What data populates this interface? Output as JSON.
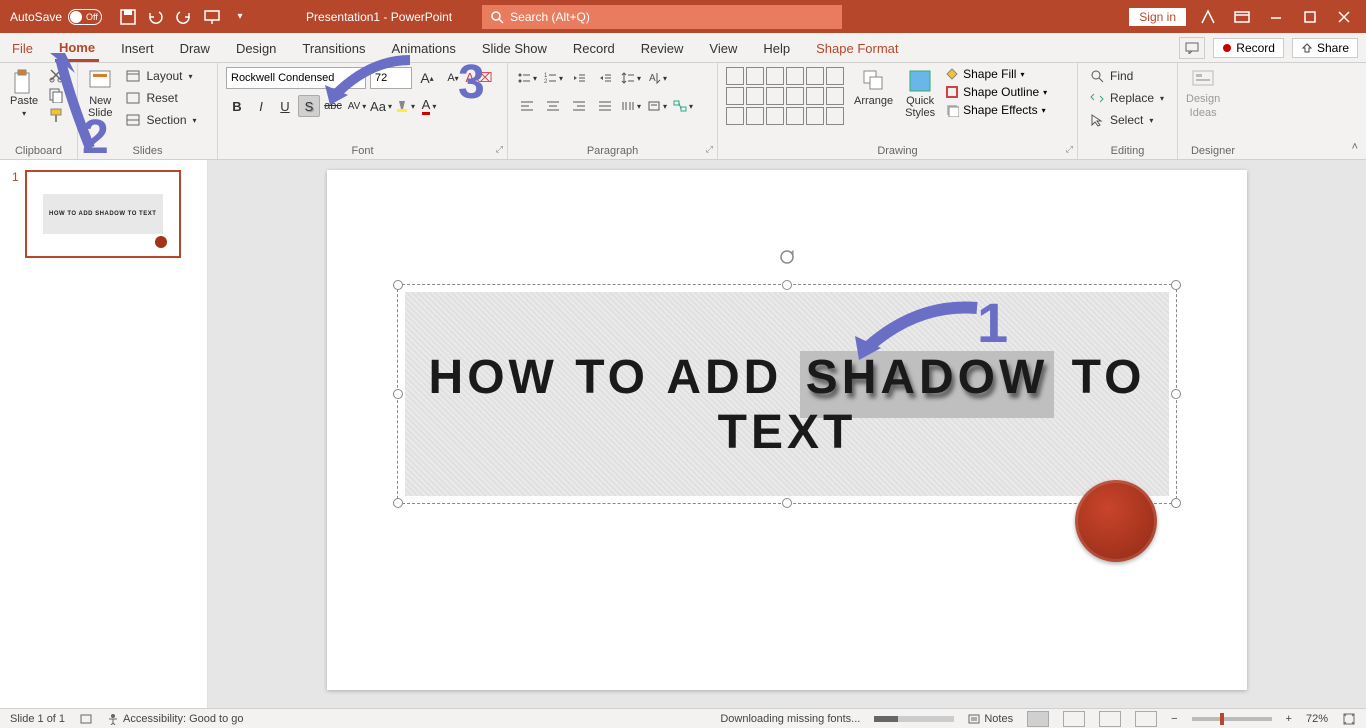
{
  "titlebar": {
    "autosave_label": "AutoSave",
    "autosave_state": "Off",
    "title": "Presentation1 - PowerPoint",
    "search_placeholder": "Search (Alt+Q)",
    "signin": "Sign in"
  },
  "tabs": {
    "items": [
      "File",
      "Home",
      "Insert",
      "Draw",
      "Design",
      "Transitions",
      "Animations",
      "Slide Show",
      "Record",
      "Review",
      "View",
      "Help",
      "Shape Format"
    ],
    "active": "Home",
    "record": "Record",
    "share": "Share"
  },
  "ribbon": {
    "clipboard": {
      "paste": "Paste",
      "label": "Clipboard"
    },
    "slides": {
      "new_slide": "New\nSlide",
      "layout": "Layout",
      "reset": "Reset",
      "section": "Section",
      "label": "Slides"
    },
    "font": {
      "name": "Rockwell Condensed",
      "size": "72",
      "label": "Font"
    },
    "paragraph": {
      "label": "Paragraph"
    },
    "drawing": {
      "arrange": "Arrange",
      "quick_styles": "Quick\nStyles",
      "shape_fill": "Shape Fill",
      "shape_outline": "Shape Outline",
      "shape_effects": "Shape Effects",
      "label": "Drawing"
    },
    "editing": {
      "find": "Find",
      "replace": "Replace",
      "select": "Select",
      "label": "Editing"
    },
    "designer": {
      "label1": "Design",
      "label2": "Ideas",
      "group": "Designer"
    }
  },
  "slide": {
    "number": "1",
    "text_parts": [
      "HOW",
      "TO",
      "ADD",
      "SHADOW",
      "TO",
      "TEXT"
    ]
  },
  "status": {
    "slide": "Slide 1 of 1",
    "accessibility": "Accessibility: Good to go",
    "downloading": "Downloading missing fonts...",
    "notes": "Notes",
    "zoom": "72%"
  },
  "anno": {
    "n1": "1",
    "n2": "2",
    "n3": "3"
  }
}
